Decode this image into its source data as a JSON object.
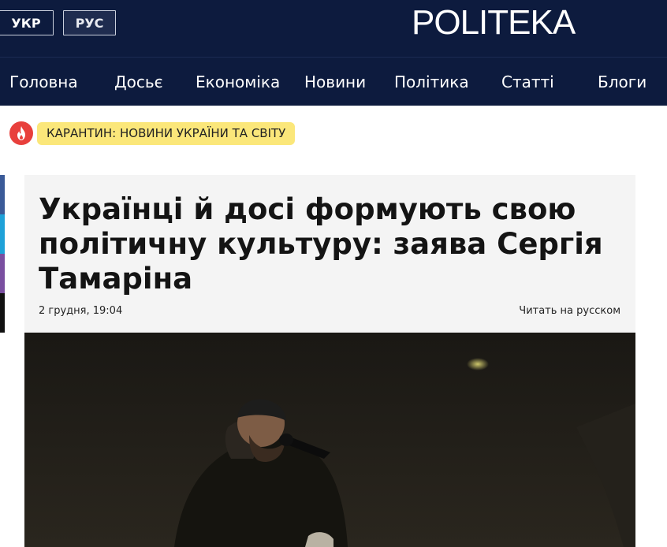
{
  "header": {
    "lang_ukr": "УКР",
    "lang_rus": "РУС",
    "logo": "POLITEKA"
  },
  "nav": {
    "items": [
      "Головна",
      "Досьє",
      "Економіка",
      "Новини",
      "Політика",
      "Статті",
      "Блоги"
    ]
  },
  "hot_topic": {
    "icon": "flame-icon",
    "label": "КАРАНТИН: НОВИНИ УКРАЇНИ ТА СВІТУ"
  },
  "article": {
    "title": "Українці й досі формують свою політичну культуру: заява Сергія Тамаріна",
    "date": "2 грудня, 19:04",
    "read_in_russian": "Читать на русском"
  },
  "colors": {
    "header_bg": "#0d1b3e",
    "hot_badge": "#e8403c",
    "hot_tag_bg": "#fbe77a",
    "card_bg": "#f4f4f4"
  }
}
